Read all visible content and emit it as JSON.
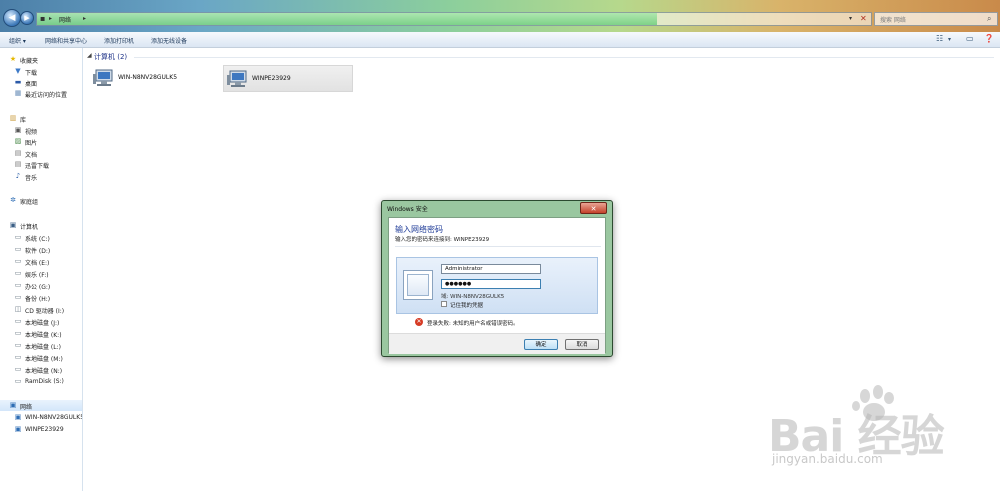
{
  "address": {
    "path": "网络"
  },
  "search": {
    "placeholder": "搜索 网络"
  },
  "toolbar": {
    "items": [
      "组织 ▾",
      "网络和共享中心",
      "添加打印机",
      "添加无线设备"
    ]
  },
  "nav": {
    "favorites": {
      "label": "收藏夹",
      "items": [
        "下载",
        "桌面",
        "最近访问的位置"
      ]
    },
    "libraries": {
      "label": "库",
      "items": [
        "视频",
        "图片",
        "文档",
        "迅雷下载",
        "音乐"
      ]
    },
    "homegroup": {
      "label": "家庭组"
    },
    "computer": {
      "label": "计算机",
      "items": [
        "系统 (C:)",
        "软件 (D:)",
        "文档 (E:)",
        "娱乐 (F:)",
        "办公 (G:)",
        "备份 (H:)",
        "CD 驱动器 (I:)",
        "本地磁盘 (J:)",
        "本地磁盘 (K:)",
        "本地磁盘 (L:)",
        "本地磁盘 (M:)",
        "本地磁盘 (N:)",
        "RamDisk (S:)"
      ]
    },
    "network": {
      "label": "网络",
      "items": [
        "WIN-N8NV28GULK5",
        "WINPE23929"
      ]
    }
  },
  "content": {
    "group_header": "计算机 (2)",
    "computers": [
      "WIN-N8NV28GULK5",
      "WINPE23929"
    ]
  },
  "dialog": {
    "title": "Windows 安全",
    "heading": "输入网络密码",
    "subtitle": "输入您的密码来连接到: WINPE23929",
    "username": "Administrator",
    "password": "●●●●●●",
    "domain": "域: WIN-N8NV28GULK5",
    "remember": "记住我的凭据",
    "error": "登录失败: 未知的用户名或错误密码。",
    "ok": "确定",
    "cancel": "取消"
  },
  "watermark": {
    "brand": "Bai 经验",
    "url": "jingyan.baidu.com"
  },
  "colors": {
    "error": "#d63b25",
    "link_heading": "#1d3a97",
    "dialog_frame": "#9ac7a0"
  }
}
